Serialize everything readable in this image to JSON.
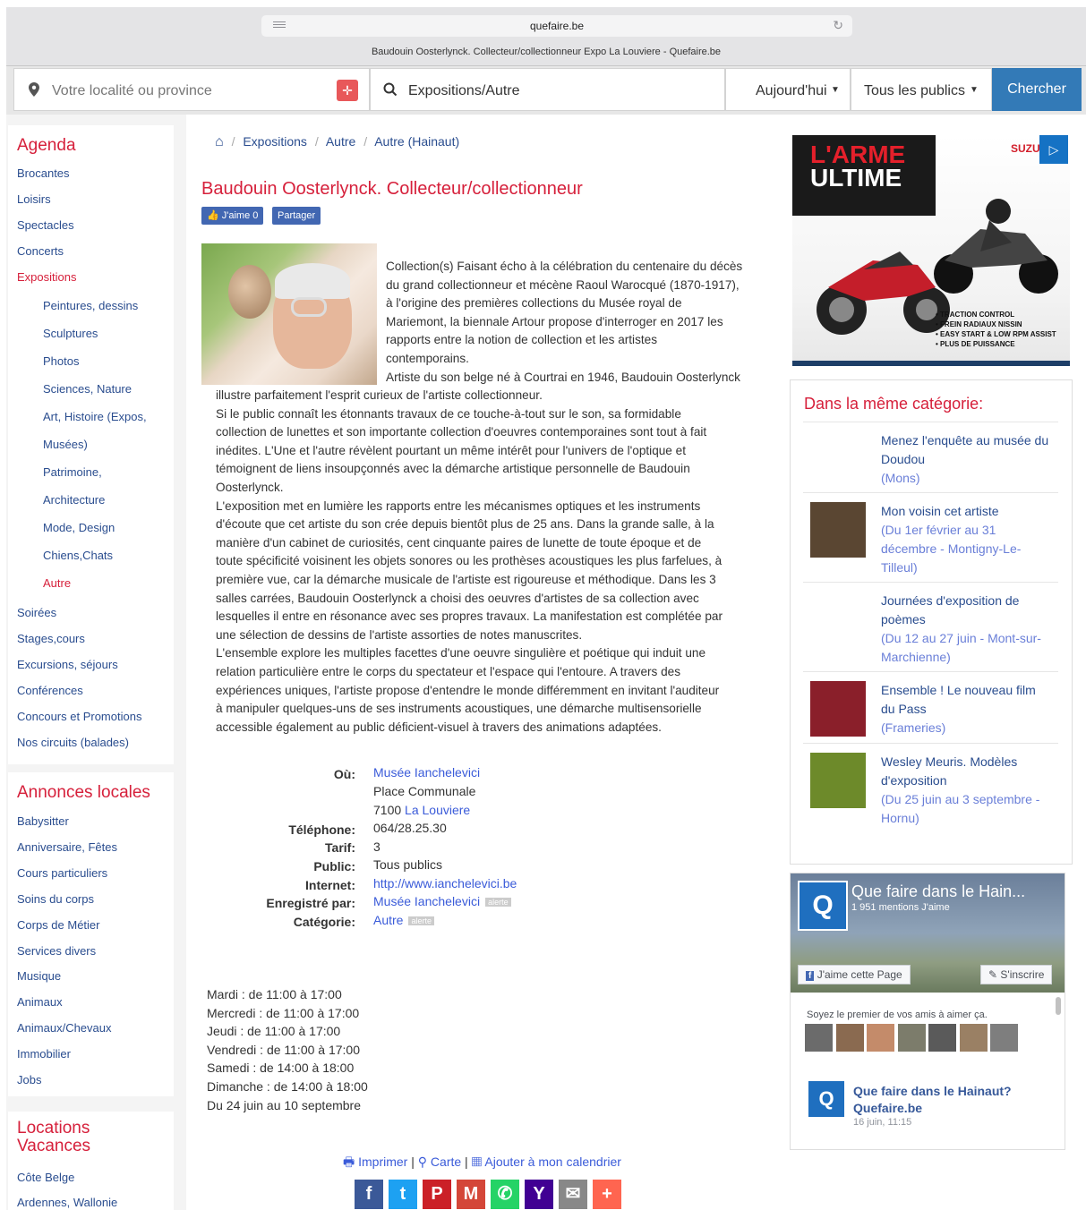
{
  "browser": {
    "url": "quefaire.be",
    "tab_title": "Baudouin Oosterlynck. Collecteur/collectionneur Expo La Louviere - Quefaire.be"
  },
  "search": {
    "location_placeholder": "Votre localité ou province",
    "what_value": "Expositions/Autre",
    "date_value": "Aujourd'hui",
    "public_value": "Tous les publics",
    "submit_label": "Chercher"
  },
  "sidebar": {
    "agenda_title": "Agenda",
    "agenda_items": [
      {
        "label": "Brocantes"
      },
      {
        "label": "Loisirs"
      },
      {
        "label": "Spectacles"
      },
      {
        "label": "Concerts"
      },
      {
        "label": "Expositions"
      },
      {
        "label": "Peintures, dessins"
      },
      {
        "label": "Sculptures"
      },
      {
        "label": "Photos"
      },
      {
        "label": "Sciences, Nature"
      },
      {
        "label": "Art, Histoire (Expos,"
      },
      {
        "label": "Musées)"
      },
      {
        "label": "Patrimoine,"
      },
      {
        "label": "Architecture"
      },
      {
        "label": "Mode, Design"
      },
      {
        "label": "Chiens,Chats"
      },
      {
        "label": "Autre"
      },
      {
        "label": "Soirées"
      },
      {
        "label": "Stages,cours"
      },
      {
        "label": "Excursions, séjours"
      },
      {
        "label": "Conférences"
      },
      {
        "label": "Concours et Promotions"
      },
      {
        "label": "Nos circuits (balades)"
      }
    ],
    "annonces_title": "Annonces locales",
    "annonces_items": [
      {
        "label": "Babysitter"
      },
      {
        "label": "Anniversaire, Fêtes"
      },
      {
        "label": "Cours particuliers"
      },
      {
        "label": "Soins du corps"
      },
      {
        "label": "Corps de Métier"
      },
      {
        "label": "Services divers"
      },
      {
        "label": "Musique"
      },
      {
        "label": "Animaux"
      },
      {
        "label": "Animaux/Chevaux"
      },
      {
        "label": "Immobilier"
      },
      {
        "label": "Jobs"
      }
    ],
    "locations_title_1": "Locations",
    "locations_title_2": "Vacances",
    "locations_items": [
      {
        "label": "Côte Belge"
      },
      {
        "label": "Ardennes, Wallonie"
      }
    ]
  },
  "breadcrumb": [
    "Expositions",
    "Autre",
    "Autre (Hainaut)"
  ],
  "event": {
    "title": "Baudouin Oosterlynck. Collecteur/collectionneur",
    "like_label": "J'aime 0",
    "share_label": "Partager",
    "desc_lines_side": [
      "Collection(s) Faisant écho à la célébration du centenaire du décès",
      "du grand collectionneur et mécène Raoul Warocqué (1870-1917),",
      "à l'origine des premières collections du Musée royal de",
      "Mariemont, la biennale Artour propose d'interroger en 2017 les",
      "rapports entre la notion de collection et les artistes",
      "contemporains.",
      "Artiste du son belge né à Courtrai en 1946, Baudouin Oosterlynck"
    ],
    "desc_lines_full": [
      "illustre parfaitement l'esprit curieux de l'artiste collectionneur.",
      "Si le public connaît les étonnants travaux de ce touche-à-tout sur le son, sa formidable",
      "collection de lunettes et son importante collection d'oeuvres contemporaines sont tout à fait",
      "inédites. L'Une et l'autre révèlent pourtant un même intérêt pour l'univers de l'optique et",
      "témoignent de liens insoupçonnés avec la démarche artistique personnelle de Baudouin",
      "Oosterlynck.",
      "L'exposition met en lumière les rapports entre les mécanismes optiques et les instruments",
      "d'écoute que cet artiste du son crée depuis bientôt plus de 25 ans. Dans la grande salle, à la",
      "manière d'un cabinet de curiosités, cent cinquante paires de lunette de toute époque et de",
      "toute spécificité voisinent les objets sonores ou les prothèses acoustiques les plus farfelues, à",
      "première vue, car la démarche musicale de l'artiste est rigoureuse et méthodique. Dans les 3",
      "salles carrées, Baudouin Oosterlynck a choisi des oeuvres d'artistes de sa collection avec",
      "lesquelles il entre en résonance avec ses propres travaux. La manifestation est complétée par",
      "une sélection de dessins de l'artiste assorties de notes manuscrites.",
      "L'ensemble explore les multiples facettes d'une oeuvre singulière et poétique qui induit une",
      "relation particulière entre le corps du spectateur et l'espace qui l'entoure. A travers des",
      "expériences uniques, l'artiste propose d'entendre le monde différemment en invitant l'auditeur",
      "à manipuler quelques-uns de ses instruments acoustiques, une démarche multisensorielle",
      "accessible également au public déficient-visuel à travers des animations adaptées."
    ],
    "info": {
      "ou_label": "Où:",
      "ou_venue": "Musée Ianchelevici",
      "ou_street": "Place Communale",
      "ou_zip": "7100",
      "ou_city": "La Louviere",
      "tel_label": "Téléphone:",
      "tel_value": "064/28.25.30",
      "tarif_label": "Tarif:",
      "tarif_value": "3",
      "public_label": "Public:",
      "public_value": "Tous publics",
      "internet_label": "Internet:",
      "internet_value": "http://www.ianchelevici.be",
      "enreg_label": "Enregistré par:",
      "enreg_value": "Musée Ianchelevici",
      "cat_label": "Catégorie:",
      "cat_value": "Autre",
      "alerte": "alerte"
    },
    "hours": [
      "Mardi : de 11:00 à 17:00",
      "Mercredi : de 11:00 à 17:00",
      "Jeudi : de 11:00 à 17:00",
      "Vendredi : de 11:00 à 17:00",
      "Samedi : de 14:00 à 18:00",
      "Dimanche : de 14:00 à 18:00",
      "Du 24 juin au 10 septembre"
    ],
    "actions": {
      "print": "Imprimer",
      "map": "Carte",
      "calendar": "Ajouter à mon calendrier"
    }
  },
  "share_buttons": [
    {
      "name": "facebook-share-button",
      "glyph": "f",
      "color": "#3b5998"
    },
    {
      "name": "twitter-share-button",
      "glyph": "t",
      "color": "#1da1f2"
    },
    {
      "name": "pinterest-share-button",
      "glyph": "P",
      "color": "#cb2027"
    },
    {
      "name": "gmail-share-button",
      "glyph": "M",
      "color": "#d44638"
    },
    {
      "name": "whatsapp-share-button",
      "glyph": "✆",
      "color": "#25d366"
    },
    {
      "name": "yahoo-share-button",
      "glyph": "Y",
      "color": "#410093"
    },
    {
      "name": "email-share-button",
      "glyph": "✉",
      "color": "#888888"
    },
    {
      "name": "more-share-button",
      "glyph": "+",
      "color": "#ff6550"
    }
  ],
  "ad": {
    "headline_1": "L'ARME",
    "headline_2": "ULTIME",
    "brand": "SUZUKI",
    "features": [
      "• TRACTION CONTROL",
      "• FREIN RADIAUX NISSIN",
      "• EASY START & LOW RPM ASSIST",
      "• PLUS DE PUISSANCE"
    ]
  },
  "same_category": {
    "title": "Dans la même catégorie:",
    "items": [
      {
        "title": "Menez l'enquête au musée du Doudou",
        "sub": "(Mons)"
      },
      {
        "title": "Mon voisin cet artiste",
        "sub": "(Du 1er février au 31 décembre - Montigny-Le-Tilleul)"
      },
      {
        "title": "Journées d'exposition de poèmes",
        "sub": "(Du 12 au 27 juin - Mont-sur-Marchienne)"
      },
      {
        "title": "Ensemble ! Le nouveau film du Pass",
        "sub": "(Frameries)"
      },
      {
        "title": "Wesley Meuris. Modèles d'exposition",
        "sub": "(Du 25 juin au 3 septembre - Hornu)"
      }
    ]
  },
  "facebook": {
    "page_name": "Que faire dans le Hain...",
    "likes": "1 951 mentions J'aime",
    "like_page": "J'aime cette Page",
    "subscribe": "S'inscrire",
    "friends_text": "Soyez le premier de vos amis à aimer ça.",
    "post_title_1": "Que faire dans le Hainaut?",
    "post_title_2": "Quefaire.be",
    "post_date": "16 juin, 11:15"
  }
}
